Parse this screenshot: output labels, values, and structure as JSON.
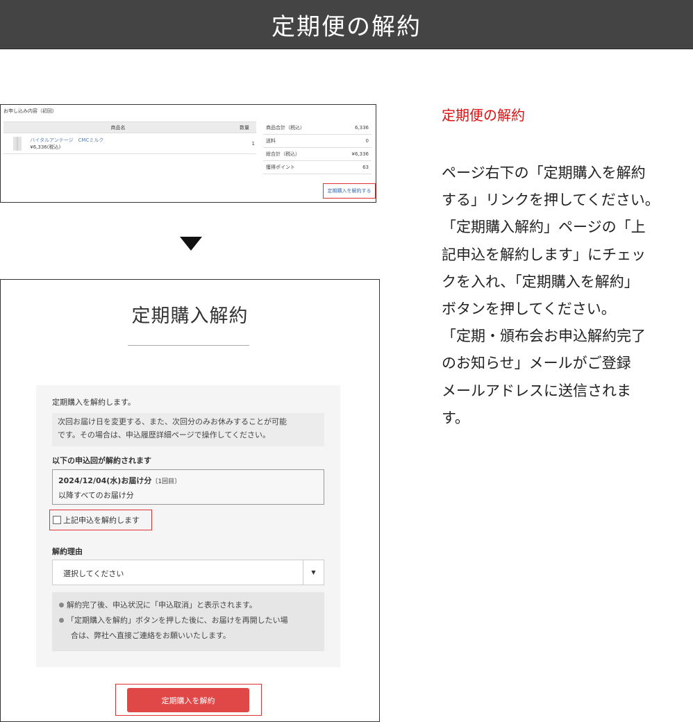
{
  "page": {
    "title": "定期便の解約"
  },
  "shot1": {
    "heading": "お申し込み内容（初回）",
    "table": {
      "col_product": "商品名",
      "col_qty": "数量",
      "product_name": "バイタルアンテージ　CMCミルク",
      "product_price": "¥6,336(税込)",
      "quantity": "1"
    },
    "summary": [
      {
        "label": "商品合計（税込）",
        "value": "6,336"
      },
      {
        "label": "送料",
        "value": "0"
      },
      {
        "label": "総合計（税込）",
        "value": "¥6,336"
      },
      {
        "label": "獲得ポイント",
        "value": "63"
      }
    ],
    "cancel_link": "定期購入を解約する"
  },
  "shot2": {
    "title": "定期購入解約",
    "intro": "定期購入を解約します。",
    "note_line1": "次回お届け日を変更する、また、次回分のみお休みすることが可能",
    "note_line2": "です。その場合は、申込履歴詳細ページで操作してください。",
    "rounds_heading": "以下の申込回が解約されます",
    "round_date": "2024/12/04(水)お届け分",
    "round_no": "〔1回目〕",
    "round_after": "以降すべてのお届け分",
    "checkbox_label": "上記申込を解約します",
    "reason_label": "解約理由",
    "reason_select": "選択してください",
    "info1": "解約完了後、申込状況に「申込取消」と表示されます。",
    "info2_line1": "「定期購入を解約」ボタンを押した後に、お届けを再開したい場",
    "info2_line2": "合は、弊社へ直接ご連絡をお願いいたします。",
    "button": "定期購入を解約"
  },
  "side": {
    "heading": "定期便の解約",
    "lines": [
      "ページ右下の「定期購入を解約",
      "する」リンクを押してください。",
      "「定期購入解約」ページの「上",
      "記申込を解約します」にチェッ",
      "クを入れ、「定期購入を解約」",
      "ボタンを押してください。",
      "「定期・頒布会お申込解約完了",
      "のお知らせ」メールがご登録",
      "メールアドレスに送信されま",
      "す。"
    ]
  },
  "colors": {
    "header_bg": "#444444",
    "accent_red": "#e01010",
    "button_red": "#e04848",
    "link_blue": "#3b6fb5"
  },
  "icons": {
    "arrow": "down-triangle-icon",
    "select": "caret-down-icon",
    "bullet": "bullet-dot-icon",
    "thumbnail": "product-thumbnail"
  }
}
